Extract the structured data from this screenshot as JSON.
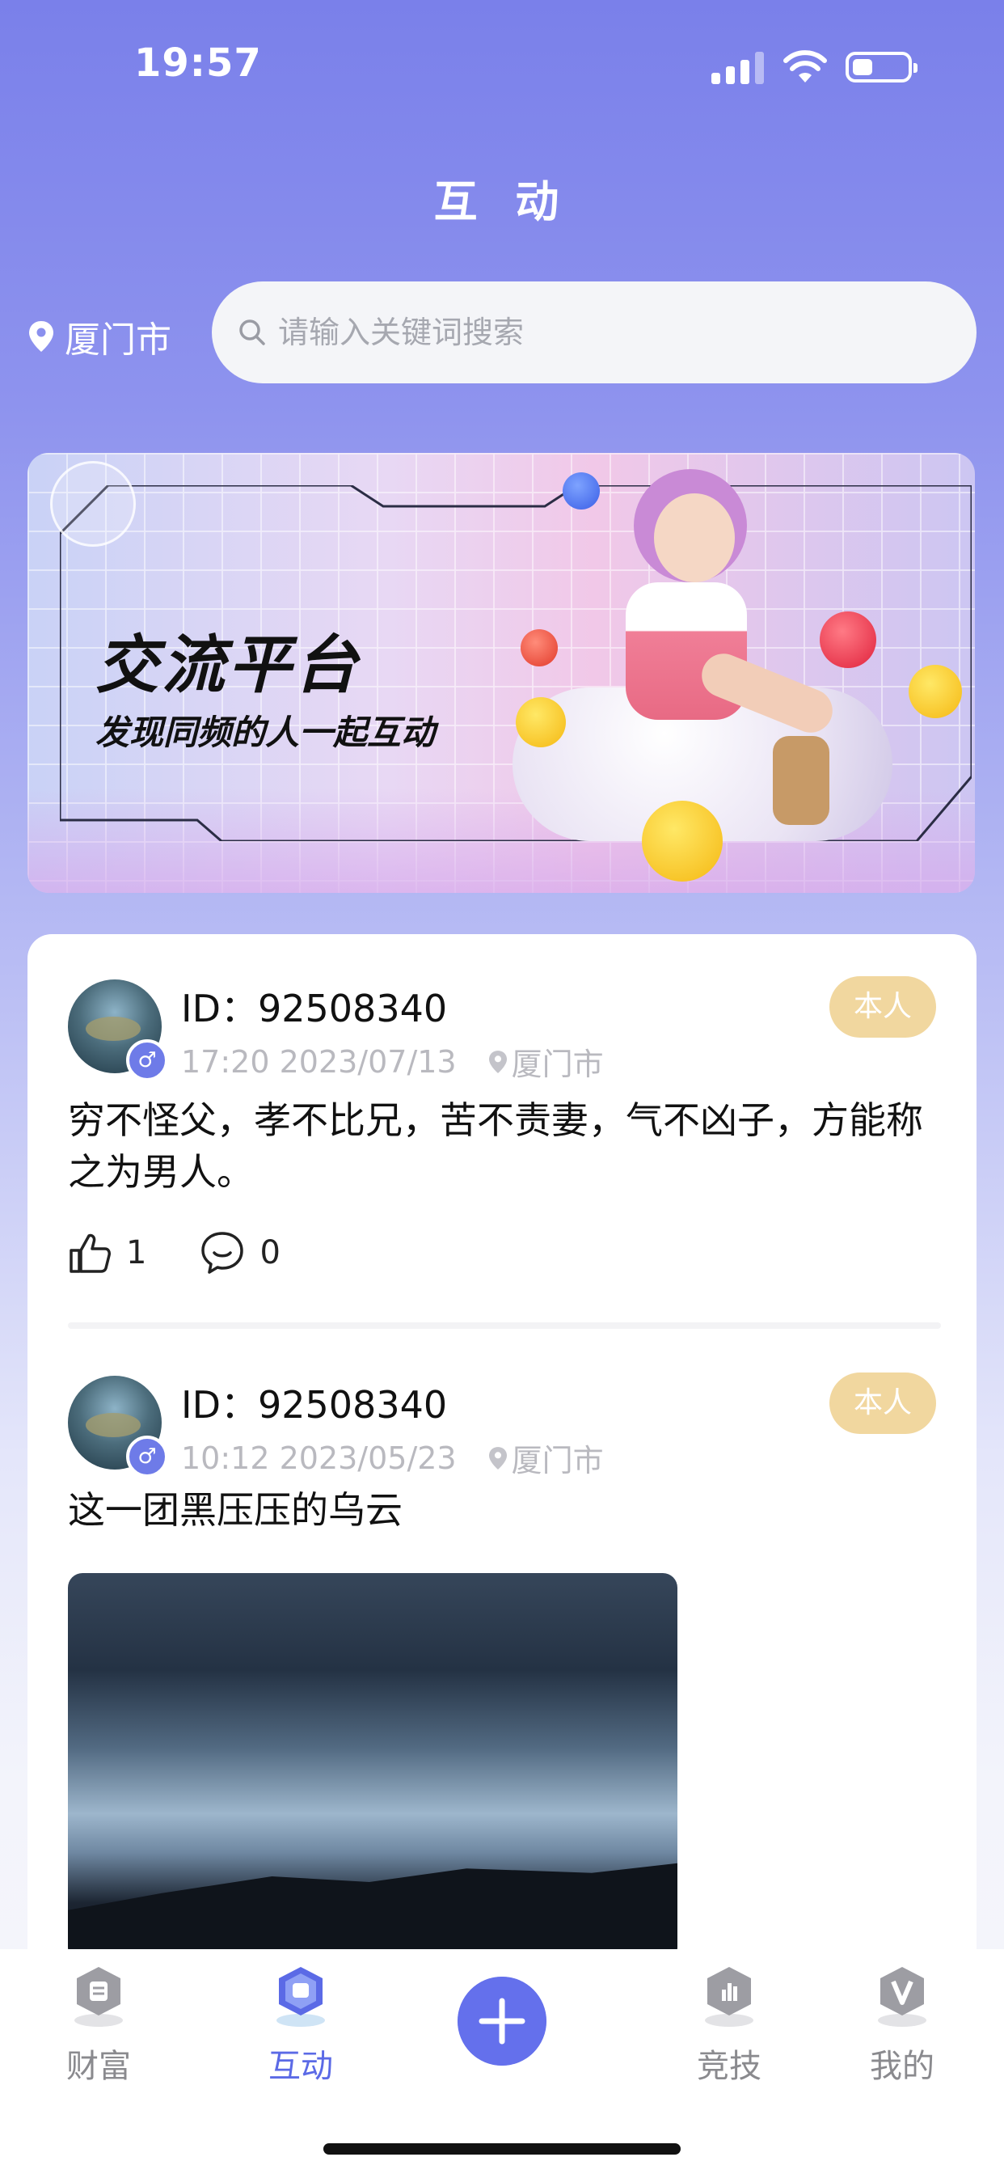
{
  "status_bar": {
    "time": "19:57"
  },
  "header": {
    "title": "互 动"
  },
  "location": {
    "city": "厦门市"
  },
  "search": {
    "placeholder": "请输入关键词搜索"
  },
  "banner": {
    "title": "交流平台",
    "subtitle": "发现同频的人一起互动"
  },
  "posts": [
    {
      "user_id": "ID：92508340",
      "time": "17:20 2023/07/13",
      "location": "厦门市",
      "badge": "本人",
      "content": "穷不怪父，孝不比兄，苦不责妻，气不凶子，方能称之为男人。",
      "likes": "1",
      "comments": "0"
    },
    {
      "user_id": "ID：92508340",
      "time": "10:12 2023/05/23",
      "location": "厦门市",
      "badge": "本人",
      "content": "这一团黑压压的乌云"
    }
  ],
  "tabbar": {
    "items": [
      {
        "label": "财富",
        "icon": "wealth-icon"
      },
      {
        "label": "互动",
        "icon": "interaction-icon",
        "active": true
      },
      {
        "label": "",
        "icon": "plus-icon"
      },
      {
        "label": "竞技",
        "icon": "competition-icon"
      },
      {
        "label": "我的",
        "icon": "profile-icon"
      }
    ]
  },
  "colors": {
    "accent": "#6470ec",
    "badge": "#f1d79f",
    "background_top": "#7a80ea"
  }
}
